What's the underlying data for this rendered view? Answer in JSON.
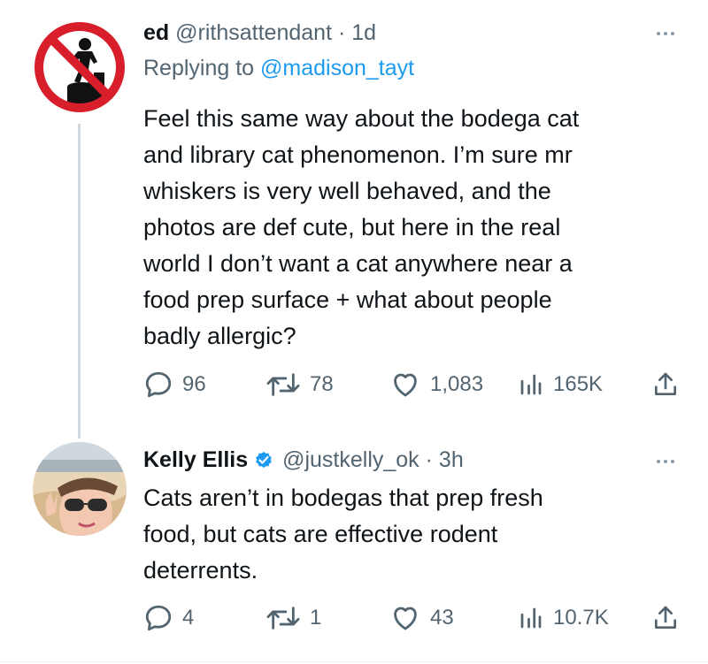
{
  "tweets": [
    {
      "author_name": "ed",
      "handle": "@rithsattendant",
      "separator": "·",
      "time": "1d",
      "verified": false,
      "replying_prefix": "Replying to",
      "replying_to": "@madison_tayt",
      "body_lines": [
        "Feel this same way about the bodega cat",
        "and library cat phenomenon. I’m sure mr",
        "whiskers is very well behaved, and the",
        "photos are def cute, but here in the real",
        "world I don’t want a cat anywhere near a",
        "food prep surface + what about people",
        "badly allergic?"
      ],
      "replies": "96",
      "retweets": "78",
      "likes": "1,083",
      "views": "165K",
      "avatar_icon": "no-standing-prohibition-icon"
    },
    {
      "author_name": "Kelly Ellis",
      "handle": "@justkelly_ok",
      "separator": "·",
      "time": "3h",
      "verified": true,
      "body_lines": [
        "Cats aren’t in bodegas that prep fresh",
        "food, but cats are effective rodent",
        "deterrents."
      ],
      "replies": "4",
      "retweets": "1",
      "likes": "43",
      "views": "10.7K",
      "avatar_icon": "profile-photo-avatar"
    }
  ],
  "colors": {
    "text": "#0f1419",
    "secondary": "#536471",
    "accent": "#1d9bf0",
    "prohibition_red": "#d81e2a"
  },
  "icons": {
    "reply": "speech-bubble-icon",
    "retweet": "retweet-arrows-icon",
    "like": "heart-icon",
    "views": "bar-chart-icon",
    "share": "share-upload-icon",
    "more": "ellipsis-icon",
    "verified": "verified-badge-icon"
  }
}
